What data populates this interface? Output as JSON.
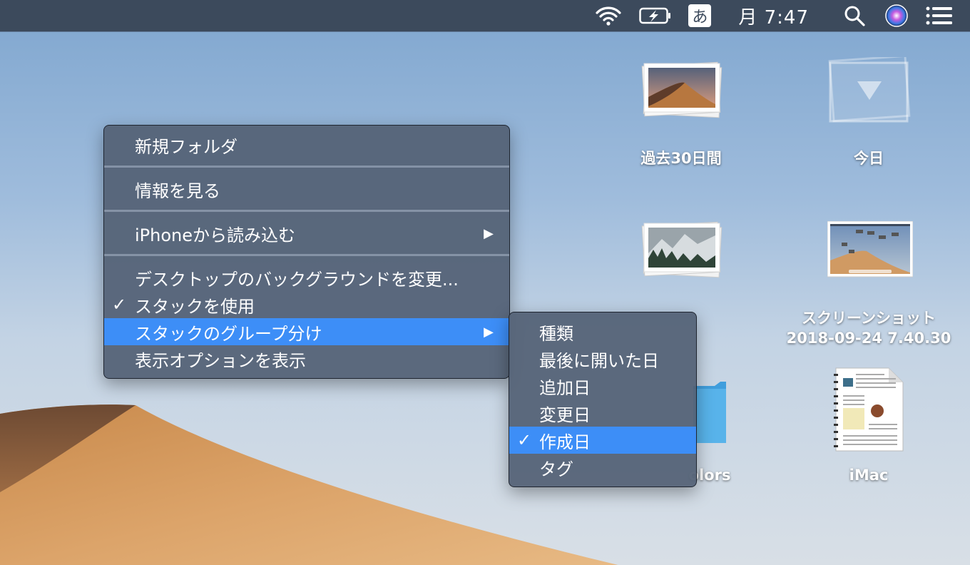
{
  "menubar": {
    "ime_label": "あ",
    "clock": "月 7:47",
    "icons": [
      "wifi-icon",
      "battery-charging-icon",
      "search-icon",
      "siri-icon",
      "notification-center-icon"
    ]
  },
  "desktop": {
    "icons": [
      {
        "label": "過去30日間",
        "kind": "photo-stack"
      },
      {
        "label": "今日",
        "kind": "empty-stack"
      },
      {
        "label": "",
        "kind": "photo-stack"
      },
      {
        "label_line1": "スクリーンショット",
        "label_line2": "2018-09-24 7.40.30",
        "kind": "screenshot"
      },
      {
        "label": "olors",
        "kind": "folder"
      },
      {
        "label": "iMac",
        "kind": "pdf-document"
      }
    ]
  },
  "context_menu": {
    "items": [
      {
        "label": "新規フォルダ"
      },
      {
        "label": "情報を見る"
      },
      {
        "label": "iPhoneから読み込む",
        "submenu": true
      },
      {
        "label": "デスクトップのバックグラウンドを変更..."
      },
      {
        "label": "スタックを使用",
        "checked": true
      },
      {
        "label": "スタックのグループ分け",
        "submenu": true,
        "highlighted": true
      },
      {
        "label": "表示オプションを表示"
      }
    ],
    "check_mark": "✓",
    "arrow": "▶"
  },
  "submenu": {
    "items": [
      {
        "label": "種類"
      },
      {
        "label": "最後に開いた日"
      },
      {
        "label": "追加日"
      },
      {
        "label": "変更日"
      },
      {
        "label": "作成日",
        "checked": true,
        "highlighted": true
      },
      {
        "label": "タグ"
      }
    ]
  },
  "colors": {
    "menubar": "#3c4a5c",
    "menu_bg": "#546276",
    "highlight": "#3d8ef7"
  }
}
